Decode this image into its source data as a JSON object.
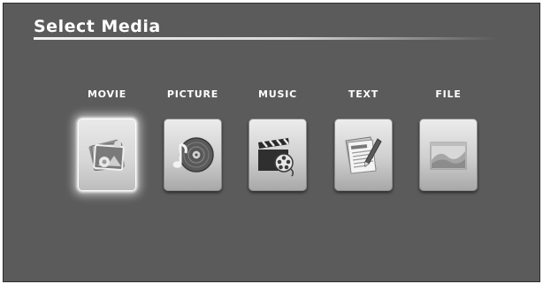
{
  "header": {
    "title": "Select Media"
  },
  "menu": {
    "items": [
      {
        "label": "MOVIE",
        "icon": "photo-stack-icon",
        "selected": true
      },
      {
        "label": "PICTURE",
        "icon": "music-disc-icon",
        "selected": false
      },
      {
        "label": "MUSIC",
        "icon": "clapperboard-film-icon",
        "selected": false
      },
      {
        "label": "TEXT",
        "icon": "document-pen-icon",
        "selected": false
      },
      {
        "label": "FILE",
        "icon": "landscape-file-icon",
        "selected": false
      }
    ]
  }
}
